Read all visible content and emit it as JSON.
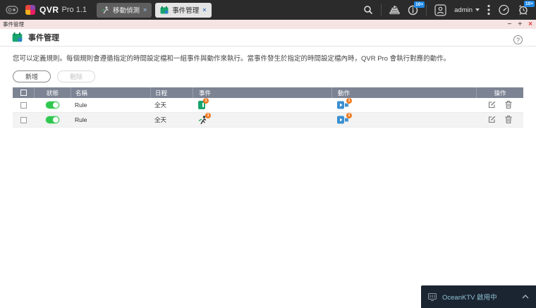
{
  "topbar": {
    "product_name": "QVR",
    "product_version": "Pro 1.1",
    "tabs": [
      {
        "label": "移動偵測",
        "close": "×"
      },
      {
        "label": "事件管理",
        "close": "×"
      }
    ],
    "username": "admin",
    "info_badge": "10+",
    "alarm_badge": "10+"
  },
  "window": {
    "title": "事件管理",
    "minimize": "−",
    "maximize": "+",
    "close": "×",
    "page_title": "事件管理",
    "help": "?"
  },
  "description": "您可以定義規則。每個規則會遵循指定的時間設定檔和一組事件與動作來執行。當事件發生於指定的時間設定檔內時，QVR Pro 會執行對應的動作。",
  "toolbar": {
    "add": "新增",
    "delete": "刪除"
  },
  "table": {
    "columns": [
      "狀態",
      "名稱",
      "日程",
      "事件",
      "動作",
      "操作"
    ],
    "rows": [
      {
        "name": "Rule",
        "schedule": "全天",
        "enabled": "on",
        "event_type": "alarm-input-event",
        "event_badge": "1",
        "action_type": "recording-action",
        "action_badge": "1"
      },
      {
        "name": "Rule",
        "schedule": "全天",
        "enabled": "on",
        "event_type": "motion-detection-event",
        "event_badge": "1",
        "action_type": "recording-action",
        "action_badge": "1"
      }
    ]
  },
  "notification": {
    "label": "OceanKTV 啟用中"
  },
  "colors": {
    "topbar_bg": "#2b2b2b",
    "titlebar_pink": "#f6e3e3",
    "table_header": "#7c8494",
    "toggle_green": "#2fc84f",
    "badge_blue": "#1e88e5",
    "badge_orange": "#f07a1d",
    "close_red": "#e0413c"
  }
}
